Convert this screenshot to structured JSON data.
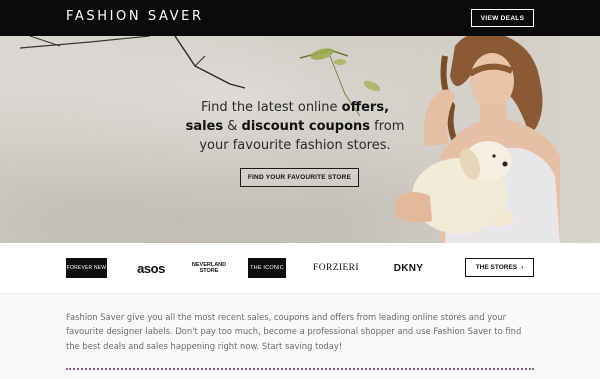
{
  "header": {
    "logo": "FASHION SAVER",
    "view_deals_label": "VIEW DEALS"
  },
  "hero": {
    "line1_pre": "Find the latest online ",
    "line1_bold": "offers,",
    "line2_bold1": "sales",
    "line2_mid": " & ",
    "line2_bold2": "discount coupons",
    "line2_post": " from",
    "line3": "your favourite fashion stores.",
    "button_label": "FIND YOUR FAVOURITE STORE"
  },
  "brands": {
    "items": [
      {
        "name": "FOREVER NEW"
      },
      {
        "name": "asos"
      },
      {
        "name_line1": "NEVERLAND",
        "name_line2": "STORE"
      },
      {
        "name": "THE ICONIC"
      },
      {
        "name": "FORZIERI"
      },
      {
        "name": "DKNY"
      }
    ],
    "stores_button_label": "THE STORES",
    "stores_button_chevron": "›"
  },
  "content": {
    "paragraph": "Fashion Saver give you all the most recent sales, coupons and offers from leading online stores and your favourite designer labels. Don't pay too much, become a professional shopper and use Fashion Saver to find the best deals and sales happening right now. Start saving today!"
  },
  "colors": {
    "header_bg": "#0b0b0b",
    "dotted_divider": "#8a5d8a",
    "content_bg": "#fbf8fb"
  }
}
